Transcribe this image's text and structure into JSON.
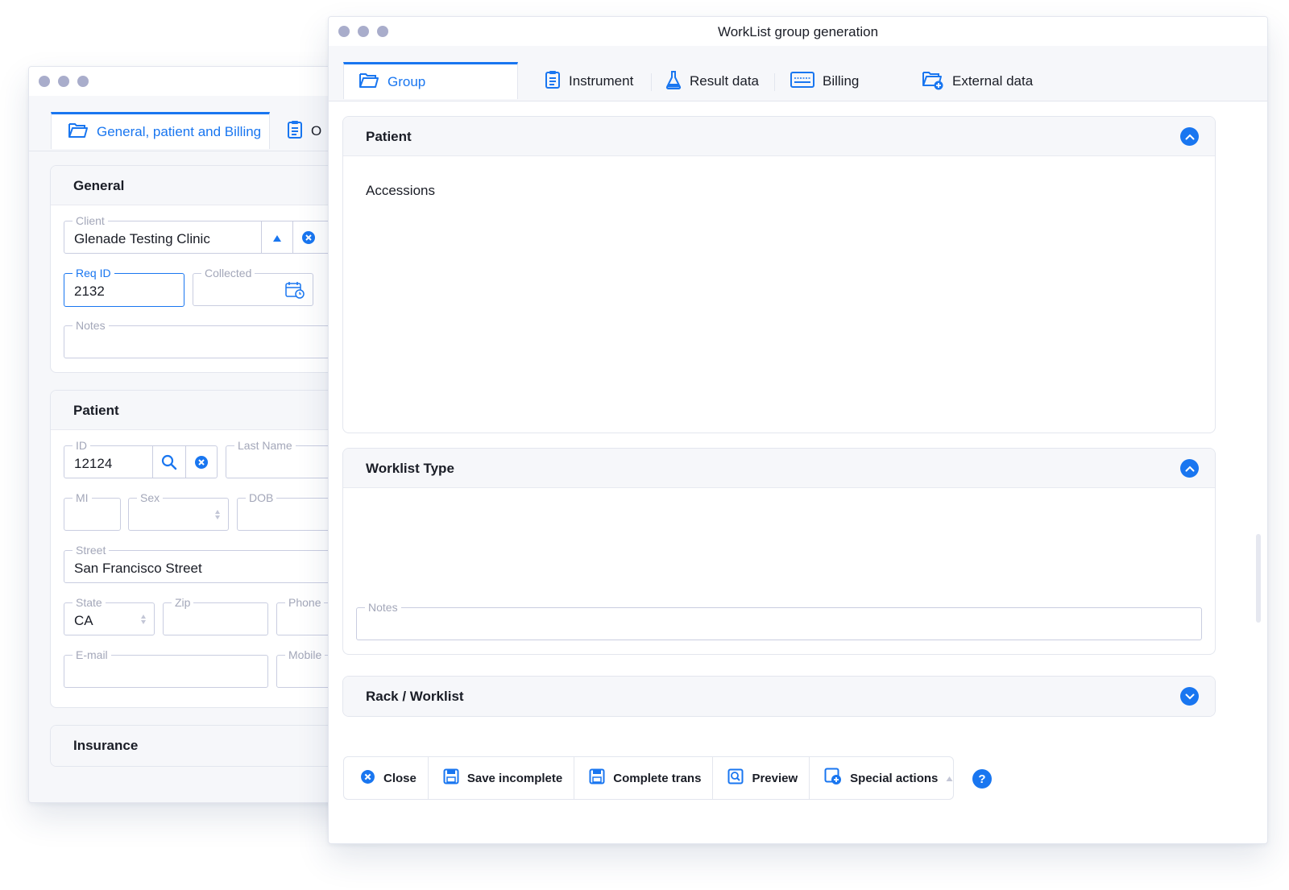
{
  "back_window": {
    "tabs": [
      {
        "label": "General, patient and Billing"
      },
      {
        "label": "O"
      }
    ],
    "general": {
      "title": "General",
      "client": {
        "label": "Client",
        "value": "Glenade Testing Clinic"
      },
      "req_id": {
        "label": "Req ID",
        "value": "2132"
      },
      "collected": {
        "label": "Collected",
        "value": ""
      },
      "notes": {
        "label": "Notes",
        "value": ""
      }
    },
    "patient": {
      "title": "Patient",
      "id": {
        "label": "ID",
        "value": "12124"
      },
      "last_name": {
        "label": "Last Name",
        "value": ""
      },
      "mi": {
        "label": "MI",
        "value": ""
      },
      "sex": {
        "label": "Sex",
        "value": ""
      },
      "dob": {
        "label": "DOB",
        "value": ""
      },
      "street": {
        "label": "Street",
        "value": "San Francisco Street"
      },
      "state": {
        "label": "State",
        "value": "CA"
      },
      "zip": {
        "label": "Zip",
        "value": ""
      },
      "phone": {
        "label": "Phone",
        "value": ""
      },
      "email": {
        "label": "E-mail",
        "value": ""
      },
      "mobile": {
        "label": "Mobile",
        "value": ""
      }
    },
    "insurance": {
      "title": "Insurance"
    }
  },
  "front_window": {
    "title": "WorkList group generation",
    "tabs": [
      {
        "label": "Group",
        "icon": "folder-open-icon"
      },
      {
        "label": "Instrument",
        "icon": "clipboard-icon"
      },
      {
        "label": "Result data",
        "icon": "flask-icon"
      },
      {
        "label": "Billing",
        "icon": "card-icon"
      },
      {
        "label": "External data",
        "icon": "folder-add-icon"
      }
    ],
    "patient_panel": {
      "title": "Patient",
      "accessions_label": "Accessions"
    },
    "worklist_type_panel": {
      "title": "Worklist Type",
      "notes": {
        "label": "Notes",
        "value": ""
      }
    },
    "rack_panel": {
      "title": "Rack / Worklist"
    },
    "toolbar": {
      "close": "Close",
      "save_incomplete": "Save incomplete",
      "complete_trans": "Complete trans",
      "preview": "Preview",
      "special_actions": "Special actions"
    },
    "help": "?"
  },
  "colors": {
    "accent": "#1976f0",
    "window_dots": "#a9adcb",
    "border": "#e3e6ee"
  }
}
